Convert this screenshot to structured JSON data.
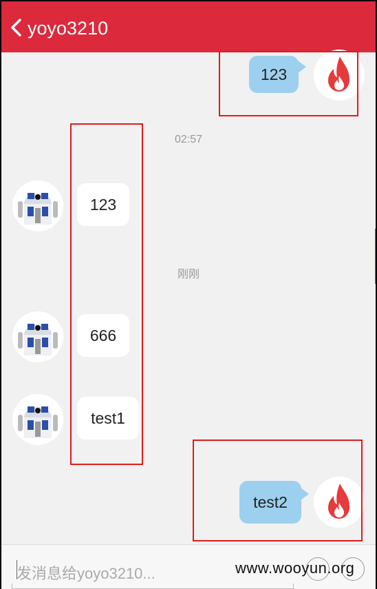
{
  "header": {
    "title": "yoyo3210"
  },
  "messages": [
    {
      "side": "me",
      "text": "123"
    },
    {
      "side": "time",
      "text": "02:57"
    },
    {
      "side": "them",
      "text": "123"
    },
    {
      "side": "time",
      "text": "刚刚"
    },
    {
      "side": "them",
      "text": "666"
    },
    {
      "side": "them",
      "text": "test1"
    },
    {
      "side": "me",
      "text": "test2"
    }
  ],
  "input": {
    "placeholder": "发消息给yoyo3210..."
  },
  "watermark": "www.wooyun.org",
  "colors": {
    "header": "#dc2a3c",
    "my_bubble": "#9dd0ee",
    "their_bubble": "#ffffff",
    "highlight_box": "#e01a1a"
  }
}
